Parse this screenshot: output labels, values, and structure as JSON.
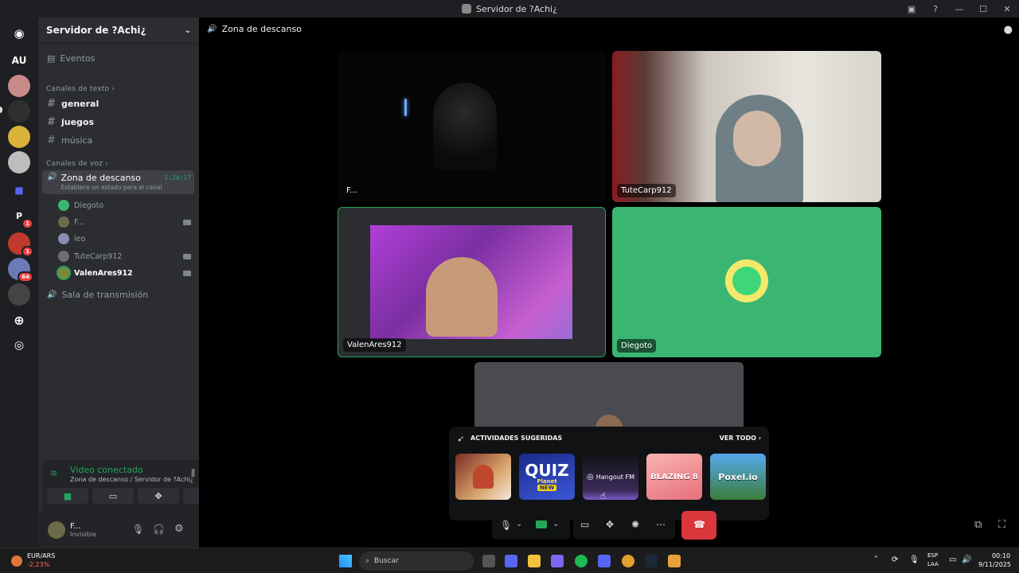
{
  "window": {
    "title": "Servidor de ?Achi¿"
  },
  "servers": {
    "initials": "AU",
    "p_label": "P",
    "badges": [
      "1",
      "1",
      "64"
    ]
  },
  "server_header": {
    "name": "Servidor de ?Achi¿"
  },
  "sidebar": {
    "events_label": "Eventos",
    "text_category": "Canales de texto",
    "text_channels": [
      "general",
      "juegos",
      "música"
    ],
    "voice_category": "Canales de voz",
    "voice_channel": {
      "name": "Zona de descanso",
      "timer": "1:24:17",
      "status": "Establece un estado para el canal"
    },
    "voice_users": [
      "Diegoto",
      "F...",
      "leo",
      "TuteCarp912",
      "ValenAres912"
    ],
    "stage_channel": "Sala de transmisión"
  },
  "voice_panel": {
    "status": "Video conectado",
    "location": "Zona de descanso / Servidor de ?Achi¿"
  },
  "user": {
    "name": "F...",
    "status": "Invisible"
  },
  "call_header": {
    "channel": "Zona de descanso"
  },
  "tiles": [
    {
      "label": "F..."
    },
    {
      "label": "TuteCarp912"
    },
    {
      "label": "ValenAres912"
    },
    {
      "label": "Diegoto"
    }
  ],
  "activities": {
    "title": "ACTIVIDADES SUGERIDAS",
    "see_all": "VER TODO",
    "games": [
      "",
      "QUIZ",
      "Hangout FM",
      "BLAZING 8",
      "Poxel.io"
    ],
    "quiz_sub": "Planet",
    "quiz_new": "NEW"
  },
  "taskbar": {
    "ticker": "EUR/ARS",
    "ticker_change": "-2,23%",
    "search": "Buscar",
    "lang": "ESP",
    "lang_sub": "LAA",
    "time": "00:10",
    "date": "9/11/2025"
  },
  "colors": {
    "accent_green": "#23a55a",
    "tile_green": "#3bb572",
    "end_call": "#da373c"
  }
}
